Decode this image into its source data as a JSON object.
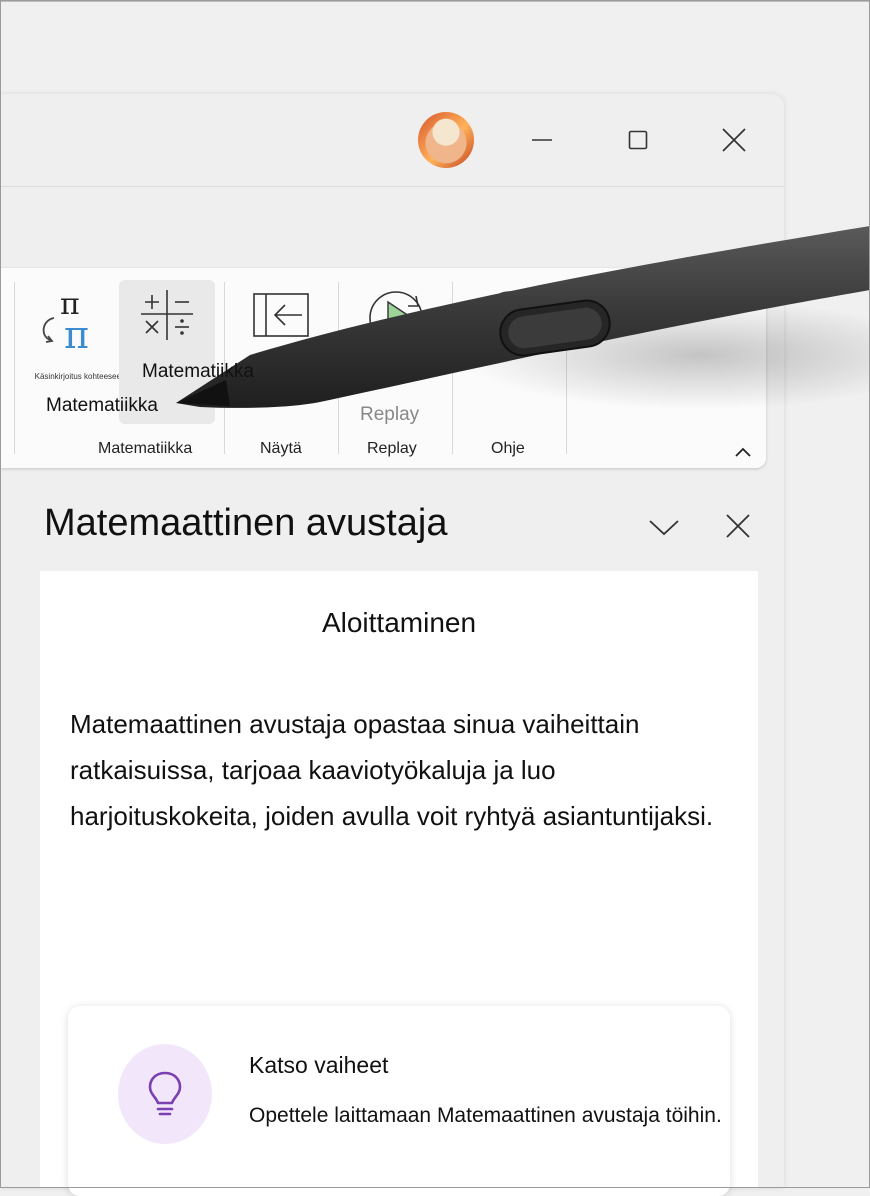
{
  "window": {
    "controls": {
      "minimize": "minimize",
      "maximize": "maximize",
      "close": "close"
    }
  },
  "ribbon": {
    "handwriting_button_label": "Käsinkirjoitus kohteeseen",
    "math_button_label": "Matematiikka",
    "tooltip_label": "Matematiikka",
    "replay_button_label": "Replay",
    "groups": {
      "math": "Matematiikka",
      "show": "Näytä",
      "replay": "Replay",
      "help": "Ohje"
    }
  },
  "pane": {
    "title": "Matemaattinen avustaja",
    "heading": "Aloittaminen",
    "body": "Matemaattinen avustaja opastaa sinua vaiheittain ratkaisuissa, tarjoaa kaaviotyökaluja ja luo harjoituskokeita, joiden avulla voit ryhtyä asiantuntijaksi.",
    "card": {
      "icon": "lightbulb-icon",
      "title": "Katso vaiheet",
      "description": "Opettele laittamaan Matemaattinen avustaja töihin."
    }
  },
  "colors": {
    "accent_purple": "#7a3fb0",
    "card_icon_bg": "#f2e6fb",
    "replay_green": "#9ed49a"
  }
}
